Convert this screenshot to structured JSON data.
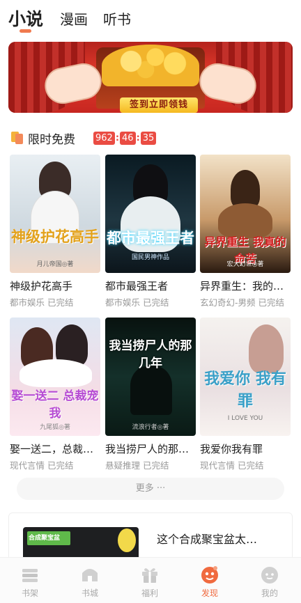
{
  "top_tabs": [
    {
      "label": "小说",
      "active": true
    },
    {
      "label": "漫画",
      "active": false
    },
    {
      "label": "听书",
      "active": false
    }
  ],
  "banner": {
    "button_label": "签到立即领钱"
  },
  "free_section": {
    "title": "限时免费",
    "timer": {
      "hours": "962",
      "minutes": "46",
      "seconds": "35"
    }
  },
  "books": [
    {
      "title": "神级护花高手",
      "meta": "都市娱乐 已完结",
      "cover_text": "神级护花高手",
      "cover_author": "月儿帝国◎著"
    },
    {
      "title": "都市最强王者",
      "meta": "都市娱乐 已完结",
      "cover_text": "都市最强王者",
      "cover_author": "国民男神作品"
    },
    {
      "title": "异界重生：我的命苦",
      "meta": "玄幻奇幻-男频 已完结",
      "cover_text": "异界重生 我真的命苦",
      "cover_author": "宏大幻世◎著"
    },
    {
      "title": "娶一送二，总裁宠我",
      "meta": "现代言情 已完结",
      "cover_text": "娶一送二 总裁宠我",
      "cover_author": "九尾狐◎著"
    },
    {
      "title": "我当捞尸人的那几年",
      "meta": "悬疑推理 已完结",
      "cover_text": "我当捞尸人的那几年",
      "cover_author": "流浪行者◎著"
    },
    {
      "title": "我爱你我有罪",
      "meta": "现代言情 已完结",
      "cover_text": "我爱你 我有罪",
      "cover_author": "I LOVE YOU"
    }
  ],
  "more_button": "更多 ···",
  "promo": {
    "title": "这个合成聚宝盆太…",
    "image_text": "合成聚宝盆"
  },
  "bottom_nav": [
    {
      "label": "书架",
      "icon": "bookshelf-icon",
      "active": false
    },
    {
      "label": "书城",
      "icon": "bookstore-icon",
      "active": false
    },
    {
      "label": "福利",
      "icon": "gift-icon",
      "active": false
    },
    {
      "label": "发现",
      "icon": "discover-icon",
      "active": true
    },
    {
      "label": "我的",
      "icon": "profile-icon",
      "active": false
    }
  ],
  "colors": {
    "accent": "#f06a3f",
    "timer_red": "#ea4c43",
    "muted_text": "#999999"
  }
}
